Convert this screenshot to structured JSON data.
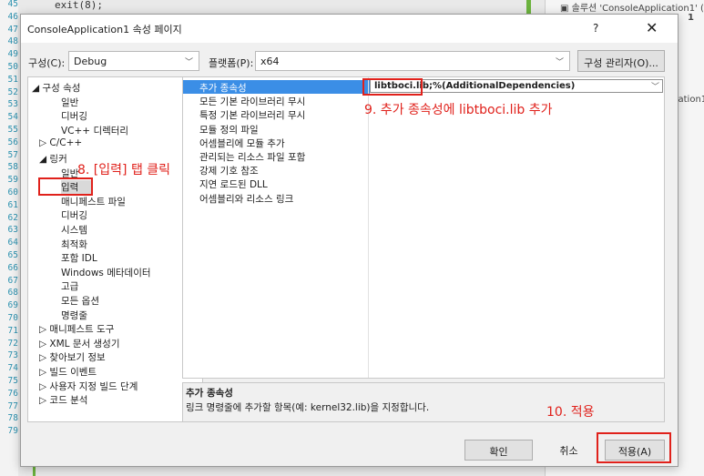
{
  "ide": {
    "code": "exit(8);",
    "line_numbers": [
      "45",
      "46",
      "47",
      "48",
      "49",
      "50",
      "51",
      "52",
      "53",
      "54",
      "55",
      "56",
      "57",
      "58",
      "59",
      "60",
      "61",
      "62",
      "63",
      "64",
      "65",
      "66",
      "67",
      "68",
      "69",
      "70",
      "71",
      "72",
      "73",
      "74",
      "75",
      "76",
      "77",
      "78",
      "79"
    ],
    "solution_text": "솔루션 'ConsoleApplication1' (",
    "solution_num": "1",
    "project_text": "cation1"
  },
  "dialog": {
    "title": "ConsoleApplication1 속성 페이지",
    "help": "?",
    "close": "✕"
  },
  "toolbar": {
    "config_label": "구성(C):",
    "config_value": "Debug",
    "platform_label": "플랫폼(P):",
    "platform_value": "x64",
    "config_manager": "구성 관리자(O)..."
  },
  "tree": [
    {
      "label": "◢ 구성 속성",
      "level": 0
    },
    {
      "label": "일반",
      "level": 2
    },
    {
      "label": "디버깅",
      "level": 2
    },
    {
      "label": "VC++ 디렉터리",
      "level": 2
    },
    {
      "label": "▷ C/C++",
      "level": 1
    },
    {
      "label": "◢ 링커",
      "level": 1
    },
    {
      "label": "일반",
      "level": 2
    },
    {
      "label": "입력",
      "level": 2,
      "selected": true
    },
    {
      "label": "매니페스트 파일",
      "level": 2
    },
    {
      "label": "디버깅",
      "level": 2
    },
    {
      "label": "시스템",
      "level": 2
    },
    {
      "label": "최적화",
      "level": 2
    },
    {
      "label": "포함 IDL",
      "level": 2
    },
    {
      "label": "Windows 메타데이터",
      "level": 2
    },
    {
      "label": "고급",
      "level": 2
    },
    {
      "label": "모든 옵션",
      "level": 2
    },
    {
      "label": "명령줄",
      "level": 2
    },
    {
      "label": "▷ 매니페스트 도구",
      "level": 1
    },
    {
      "label": "▷ XML 문서 생성기",
      "level": 1
    },
    {
      "label": "▷ 찾아보기 정보",
      "level": 1
    },
    {
      "label": "▷ 빌드 이벤트",
      "level": 1
    },
    {
      "label": "▷ 사용자 지정 빌드 단계",
      "level": 1
    },
    {
      "label": "▷ 코드 분석",
      "level": 1
    }
  ],
  "properties": [
    {
      "name": "추가 종속성",
      "selected": true
    },
    {
      "name": "모든 기본 라이브러리 무시"
    },
    {
      "name": "특정 기본 라이브러리 무시"
    },
    {
      "name": "모듈 정의 파일"
    },
    {
      "name": "어셈블리에 모듈 추가"
    },
    {
      "name": "관리되는 리소스 파일 포함"
    },
    {
      "name": "강제 기호 참조"
    },
    {
      "name": "지연 로드된 DLL"
    },
    {
      "name": "어셈블리와 리소스 링크"
    }
  ],
  "selected_value": "libtboci.lib;%(AdditionalDependencies)",
  "description": {
    "heading": "추가 종속성",
    "text": "링크 명령줄에 추가할 항목(예: kernel32.lib)을 지정합니다."
  },
  "buttons": {
    "ok": "확인",
    "cancel": "취소",
    "apply": "적용(A)"
  },
  "annotations": {
    "step8": "8. [입력] 탭 클릭",
    "step9": "9. 추가 종속성에 libtboci.lib 추가",
    "step10": "10. 적용",
    "color": "#e0211b"
  }
}
